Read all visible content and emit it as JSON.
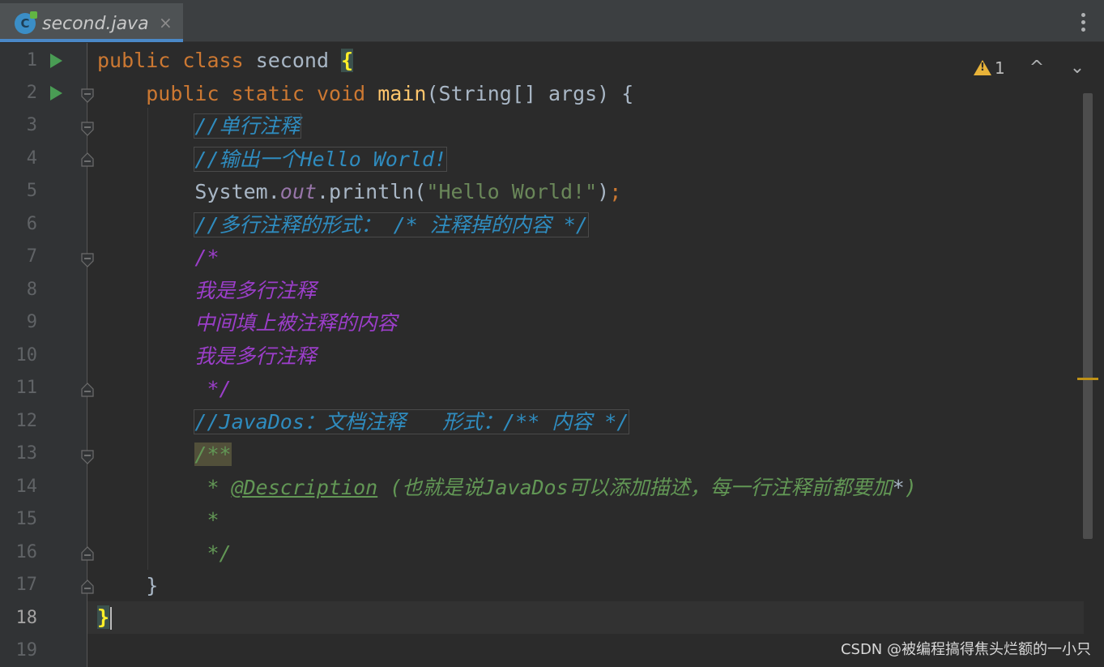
{
  "tab": {
    "title": "second.java",
    "close": "×",
    "icon": "java-class-icon"
  },
  "inspection": {
    "warning_count": "1",
    "up": "^",
    "down": "⌄"
  },
  "gutter": {
    "line_numbers": [
      "1",
      "2",
      "3",
      "4",
      "5",
      "6",
      "7",
      "8",
      "9",
      "10",
      "11",
      "12",
      "13",
      "14",
      "15",
      "16",
      "17",
      "18",
      "19"
    ],
    "active_line": "18"
  },
  "code": {
    "l1": {
      "kw1": "public",
      "kw2": "class",
      "name": "second",
      "brace": "{"
    },
    "l2": {
      "kw1": "public",
      "kw2": "static",
      "kw3": "void",
      "fn": "main",
      "rest": "(String[] args) {"
    },
    "l3": "//单行注释",
    "l4": "//输出一个Hello World!",
    "l5": {
      "a": "System.",
      "field": "out",
      "b": ".println(",
      "str": "\"Hello World!\"",
      "c": ")",
      "semi": ";"
    },
    "l6": "//多行注释的形式： /* 注释掉的内容 */",
    "l7": "/*",
    "l8": "我是多行注释",
    "l9": "中间填上被注释的内容",
    "l10": "我是多行注释",
    "l11": " */",
    "l12": "//JavaDos：文档注释   形式：/** 内容 */",
    "l13": "/**",
    "l14": {
      "star": " * ",
      "tag": "@Description",
      "text": " (也就是说JavaDos可以添加描述，每一行注释前都要加",
      "star2": "*",
      "end": ")"
    },
    "l15": " *",
    "l16": " */",
    "l17": "}",
    "l18": "}"
  },
  "watermark": "CSDN @被编程搞得焦头烂额的一小只"
}
